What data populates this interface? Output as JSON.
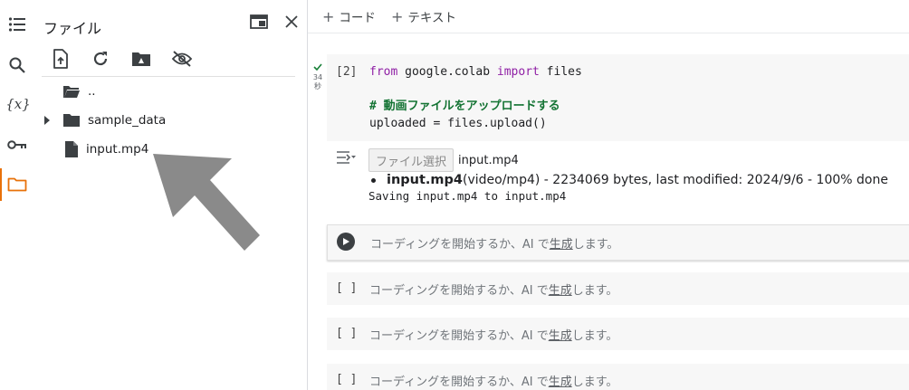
{
  "rail": {
    "icons": [
      "list-icon",
      "search-icon",
      "variables-icon",
      "key-icon",
      "folder-icon"
    ],
    "variables_glyph": "{x}"
  },
  "panel": {
    "title": "ファイル",
    "toolbar_icons": [
      "upload-icon",
      "refresh-icon",
      "drive-folder-icon",
      "hide-icon"
    ],
    "tree": [
      {
        "label": "..",
        "type": "folder-parent"
      },
      {
        "label": "sample_data",
        "type": "folder"
      },
      {
        "label": "input.mp4",
        "type": "file"
      }
    ]
  },
  "topbar": {
    "add_code": "コード",
    "add_text": "テキスト"
  },
  "cell1": {
    "prompt": "[2]",
    "exec_time": "34",
    "exec_unit": "秒",
    "line1_kw1": "from",
    "line1_mod": " google.colab ",
    "line1_kw2": "import",
    "line1_rest": " files",
    "comment": "# 動画ファイルをアップロードする",
    "line3": "uploaded = files.upload()"
  },
  "output": {
    "file_button": "ファイル選択",
    "file_name": "input.mp4",
    "detail_name": "input.mp4",
    "detail_rest": "(video/mp4) - 2234069 bytes, last modified: 2024/9/6 - 100% done",
    "saving": "Saving input.mp4 to input.mp4"
  },
  "empty_cells": {
    "bracket": "[ ]",
    "placeholder_pre": "コーディングを開始するか、AI で",
    "placeholder_link": "生成",
    "placeholder_post": "します。"
  },
  "colors": {
    "accent": "#e8710a",
    "comment": "#137333",
    "keyword": "#8f1fa5"
  }
}
